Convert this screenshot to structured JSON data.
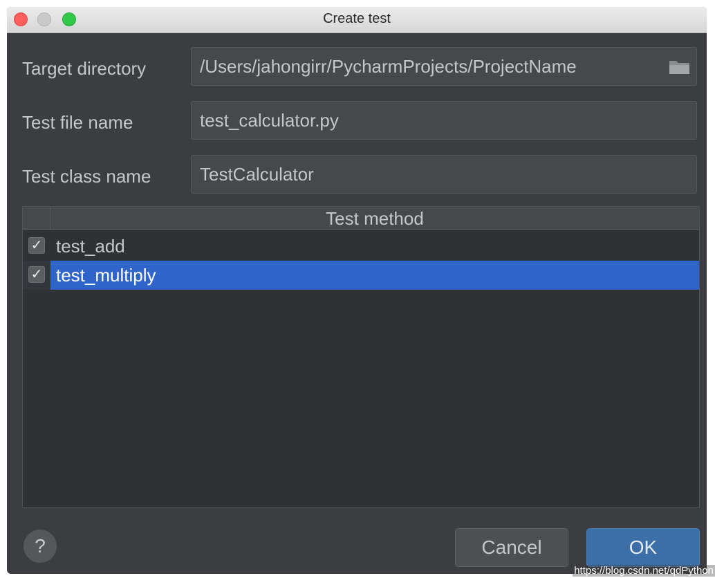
{
  "window": {
    "title": "Create test"
  },
  "form": {
    "target_directory_label": "Target directory",
    "target_directory_value": "/Users/jahongirr/PycharmProjects/ProjectName",
    "test_file_name_label": "Test file name",
    "test_file_name_value": "test_calculator.py",
    "test_class_name_label": "Test class name",
    "test_class_name_value": "TestCalculator"
  },
  "table": {
    "header": "Test method",
    "rows": [
      {
        "name": "test_add",
        "checked": true,
        "selected": false
      },
      {
        "name": "test_multiply",
        "checked": true,
        "selected": true
      }
    ]
  },
  "footer": {
    "help_label": "?",
    "cancel_label": "Cancel",
    "ok_label": "OK"
  },
  "watermark": "https://blog.csdn.net/qdPython",
  "icons": {
    "check": "✓",
    "folder": "folder-icon"
  },
  "colors": {
    "selection": "#2f65ca",
    "ok_button": "#3c6ea8"
  }
}
